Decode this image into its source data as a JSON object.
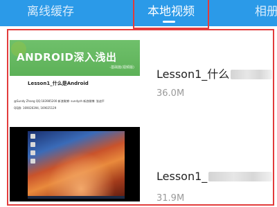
{
  "tabs": [
    {
      "label": "离线缓存",
      "active": false
    },
    {
      "label": "本地视频",
      "active": true
    },
    {
      "label": "相册",
      "active": false
    }
  ],
  "colors": {
    "accent": "#2b9ae8",
    "annotation": "#e23b3b"
  },
  "videos": [
    {
      "title": "Lesson1_什么",
      "size": "36.0M",
      "thumbnail": {
        "heading": "ANDROID深入浅出",
        "subheading": "-基础篇(视频版)",
        "lesson": "Lesson1_什么是Android",
        "footer_line1": "@Sundy Zhang  QQ:183985200  新浪微博: sundyzh  新浪微博: 张迪平",
        "footer_line2": "QQ群: 169026394, 169025129"
      }
    },
    {
      "title": "Lesson1_",
      "size": "31.9M"
    }
  ]
}
